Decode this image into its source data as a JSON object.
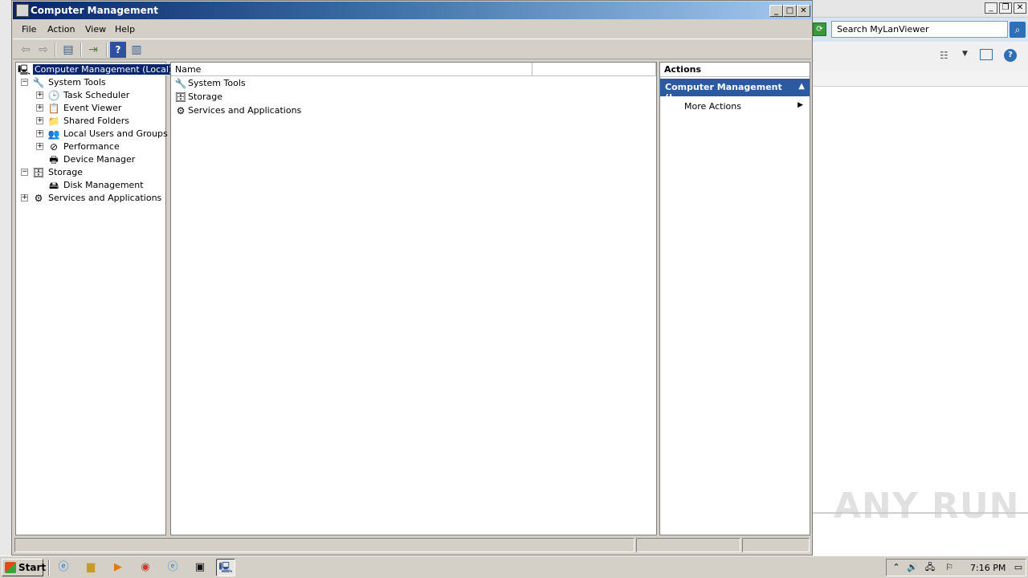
{
  "background_window": {
    "search_placeholder": "Search MyLanViewer",
    "watermark": "ANY RUN"
  },
  "window": {
    "title": "Computer Management",
    "minimize": "_",
    "maximize": "□",
    "close": "✕"
  },
  "menu": [
    "File",
    "Action",
    "View",
    "Help"
  ],
  "tree": {
    "root": "Computer Management (Local)",
    "items": [
      {
        "label": "System Tools",
        "level": 1,
        "toggle": "−",
        "icon": "tools-icon"
      },
      {
        "label": "Task Scheduler",
        "level": 2,
        "toggle": "+",
        "icon": "clock-icon"
      },
      {
        "label": "Event Viewer",
        "level": 2,
        "toggle": "+",
        "icon": "event-viewer-icon"
      },
      {
        "label": "Shared Folders",
        "level": 2,
        "toggle": "+",
        "icon": "shared-folder-icon"
      },
      {
        "label": "Local Users and Groups",
        "level": 2,
        "toggle": "+",
        "icon": "users-icon"
      },
      {
        "label": "Performance",
        "level": 2,
        "toggle": "+",
        "icon": "performance-icon"
      },
      {
        "label": "Device Manager",
        "level": 2,
        "toggle": "",
        "icon": "device-manager-icon"
      },
      {
        "label": "Storage",
        "level": 1,
        "toggle": "−",
        "icon": "storage-icon"
      },
      {
        "label": "Disk Management",
        "level": 2,
        "toggle": "",
        "icon": "disk-icon"
      },
      {
        "label": "Services and Applications",
        "level": 1,
        "toggle": "+",
        "icon": "services-icon"
      }
    ]
  },
  "list": {
    "column_name": "Name",
    "column_2": "",
    "items": [
      {
        "label": "System Tools",
        "icon": "tools-icon"
      },
      {
        "label": "Storage",
        "icon": "storage-icon"
      },
      {
        "label": "Services and Applications",
        "icon": "services-icon"
      }
    ]
  },
  "actions": {
    "header": "Actions",
    "section": "Computer Management (L...",
    "collapse": "▲",
    "more": "More Actions",
    "more_arrow": "▶"
  },
  "taskbar": {
    "start": "Start",
    "clock": "7:16 PM"
  }
}
